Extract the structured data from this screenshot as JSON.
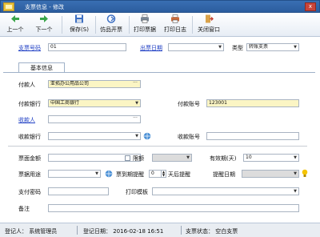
{
  "window": {
    "title": "支票信息 - 修改",
    "close_label": "x"
  },
  "toolbar": {
    "prev": "上一个",
    "next": "下一个",
    "save": "保存(S)",
    "copy": "仿品开票",
    "print_cheque": "打印票据",
    "print_log": "打印日志",
    "close": "关闭窗口"
  },
  "header": {
    "cheque_no_label": "支票号码",
    "cheque_no_value": "01",
    "date_label": "出票日期",
    "date_value": "",
    "type_label": "类型",
    "type_value": "转账支票"
  },
  "tab": {
    "basic": "基本信息"
  },
  "form": {
    "payer_label": "付款人",
    "payer_value": "亚拓办公用品公司",
    "payer_bank_label": "付款银行",
    "payer_bank_value": "中国工商银行",
    "payer_account_label": "付款账号",
    "payer_account_value": "123001",
    "payee_label": "收款人",
    "payee_value": "",
    "payee_bank_label": "收款银行",
    "payee_bank_value": "",
    "payee_account_label": "收款账号",
    "payee_account_value": "",
    "amount_label": "票面金额",
    "amount_value": "",
    "limit_label": "限额",
    "limit_value": "",
    "valid_label": "有效期(天)",
    "valid_value": "10",
    "purpose_label": "票据用途",
    "purpose_value": "",
    "remind_label": "票到期提醒",
    "remind_value": "0",
    "remind_unit": "天后提醒",
    "remind_date_label": "提醒日期",
    "remind_date_value": "",
    "password_label": "支付密码",
    "password_value": "",
    "template_label": "打印模板",
    "template_value": "",
    "note_label": "备注",
    "note_value": ""
  },
  "status": {
    "registrant": "登记人：  系统管理员",
    "reg_date": "登记日期：  2016-02-18 16:51",
    "cheque_status": "支票状态：  空白支票"
  },
  "colors": {
    "titlebar": "#2c5d9e",
    "highlight_label": "#1f3fc4",
    "required_field": "#fbf5c4"
  }
}
